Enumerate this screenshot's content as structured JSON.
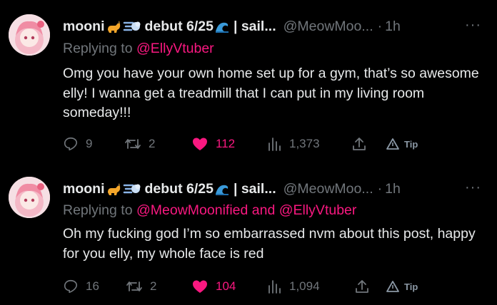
{
  "tweets": [
    {
      "name": "mooni",
      "name_suffix": "debut 6/25",
      "name_tail": "| sail...",
      "handle": "@MeowMoo...",
      "time": "1h",
      "reply_prefix": "Replying to ",
      "reply_link": "@EllyVtuber",
      "text": "Omg you have your own home set up for a gym, that’s so awesome elly! I wanna get a treadmill that I can put in my living room someday!!!",
      "replies": "9",
      "retweets": "2",
      "likes": "112",
      "views": "1,373",
      "tip": "Tip"
    },
    {
      "name": "mooni",
      "name_suffix": "debut 6/25",
      "name_tail": "| sail...",
      "handle": "@MeowMoo...",
      "time": "1h",
      "reply_prefix": "Replying to ",
      "reply_link": "@MeowMoonified and @EllyVtuber",
      "text": "Oh my fucking god I’m so embarrassed nvm about this post, happy for you elly, my whole face is red",
      "replies": "16",
      "retweets": "2",
      "likes": "104",
      "views": "1,094",
      "tip": "Tip"
    }
  ],
  "colors": {
    "like": "#f91880",
    "muted": "#71767b",
    "text": "#e7e9ea",
    "background": "#000000"
  },
  "icons": [
    "cat-icon",
    "dash-icon",
    "wave-icon",
    "reply-icon",
    "retweet-icon",
    "heart-icon",
    "views-icon",
    "share-icon",
    "tip-icon",
    "more-icon"
  ]
}
